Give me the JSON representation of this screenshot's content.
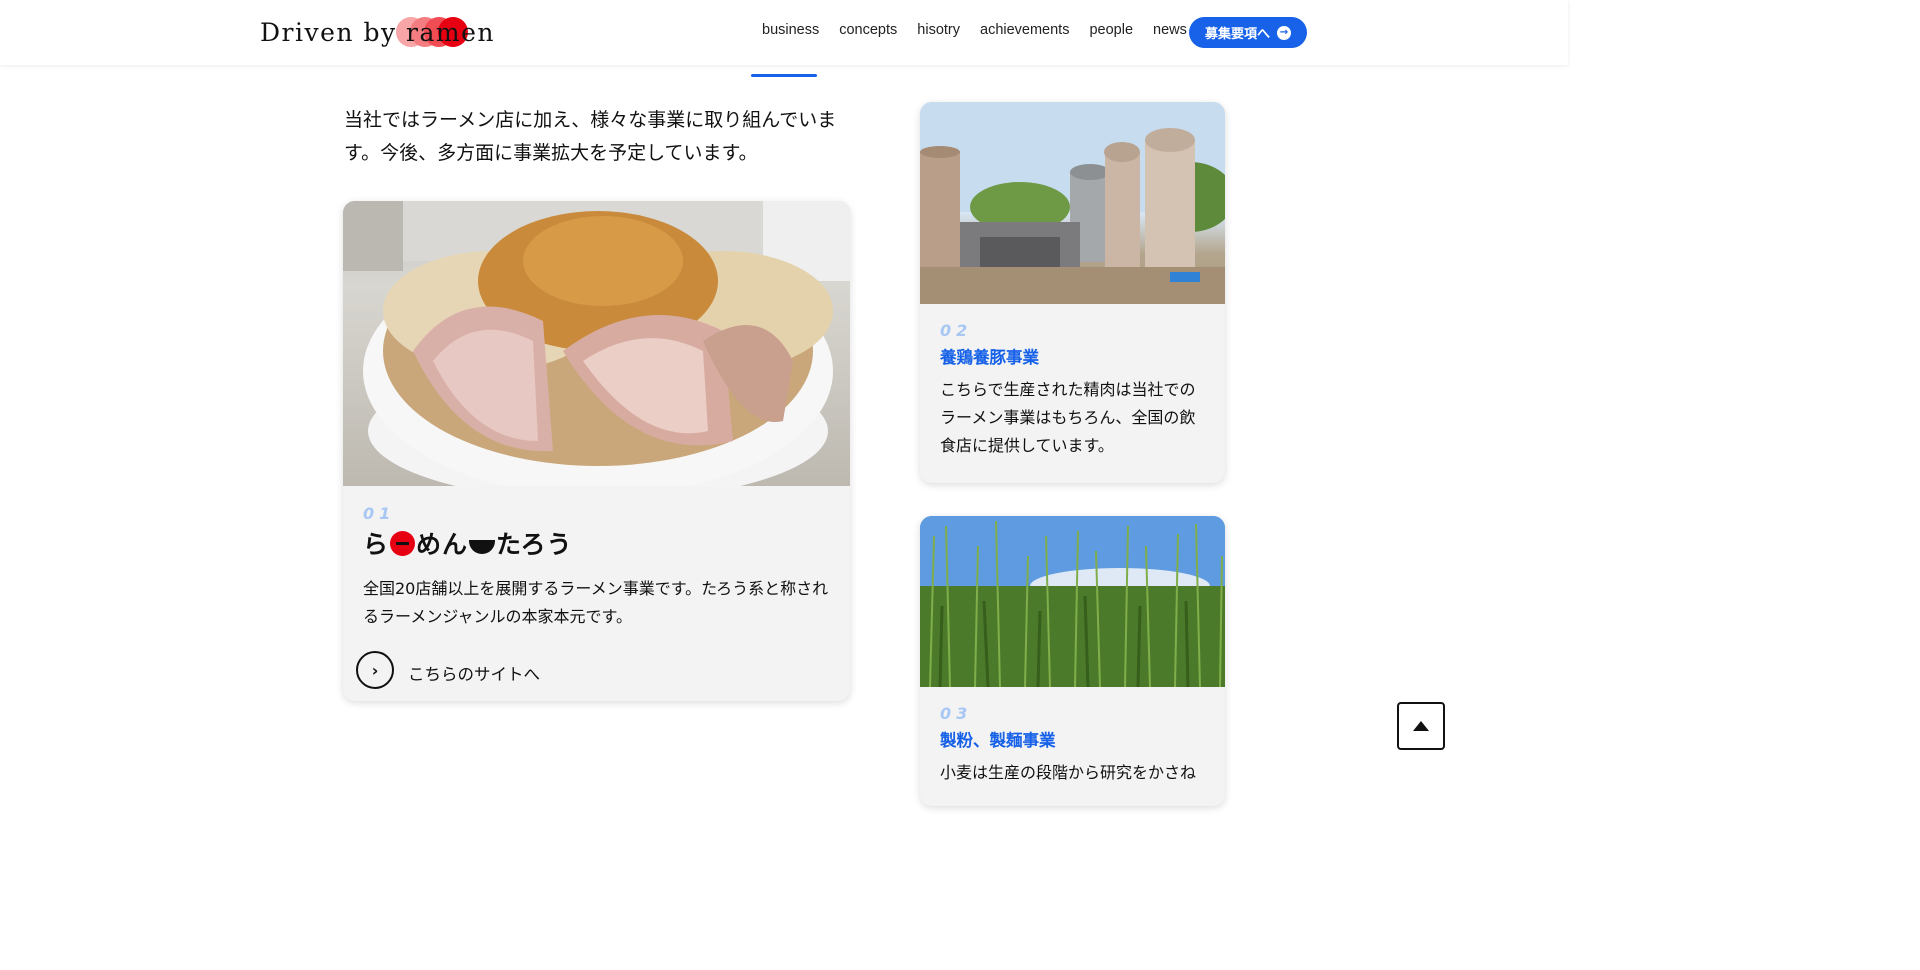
{
  "header": {
    "logo": "Driven by ramen",
    "nav": [
      {
        "id": "business",
        "label": "business"
      },
      {
        "id": "concepts",
        "label": "concepts"
      },
      {
        "id": "hisotry",
        "label": "hisotry"
      },
      {
        "id": "achievements",
        "label": "achievements"
      },
      {
        "id": "people",
        "label": "people"
      },
      {
        "id": "news",
        "label": "news"
      }
    ],
    "recruit_label": "募集要項へ",
    "recruit_icon": "arrow-right-circle-icon"
  },
  "intro": "当社ではラーメン店に加え、様々な事業に取り組んでいます。今後、多方面に事業拡大を予定しています。",
  "cards": [
    {
      "num": "01",
      "brand_parts": [
        "ら",
        "めん",
        "たろう"
      ],
      "desc": "全国20店舗以上を展開するラーメン事業です。たろう系と称されるラーメンジャンルの本家本元です。",
      "link_label": "こちらのサイトへ",
      "image": "ramen-bowl-photo"
    },
    {
      "num": "02",
      "title": "養鶏養豚事業",
      "desc": "こちらで生産された精肉は当社でのラーメン事業はもちろん、全国の飲食店に提供しています。",
      "image": "farm-silos-photo"
    },
    {
      "num": "03",
      "title": "製粉、製麺事業",
      "desc": "小麦は生産の段階から研究をかさね",
      "image": "wheat-field-photo"
    }
  ],
  "colors": {
    "accent": "#1762e8",
    "brand_red": "#e60012",
    "card_bg": "#f3f3f3",
    "num": "#a9c7f5"
  }
}
